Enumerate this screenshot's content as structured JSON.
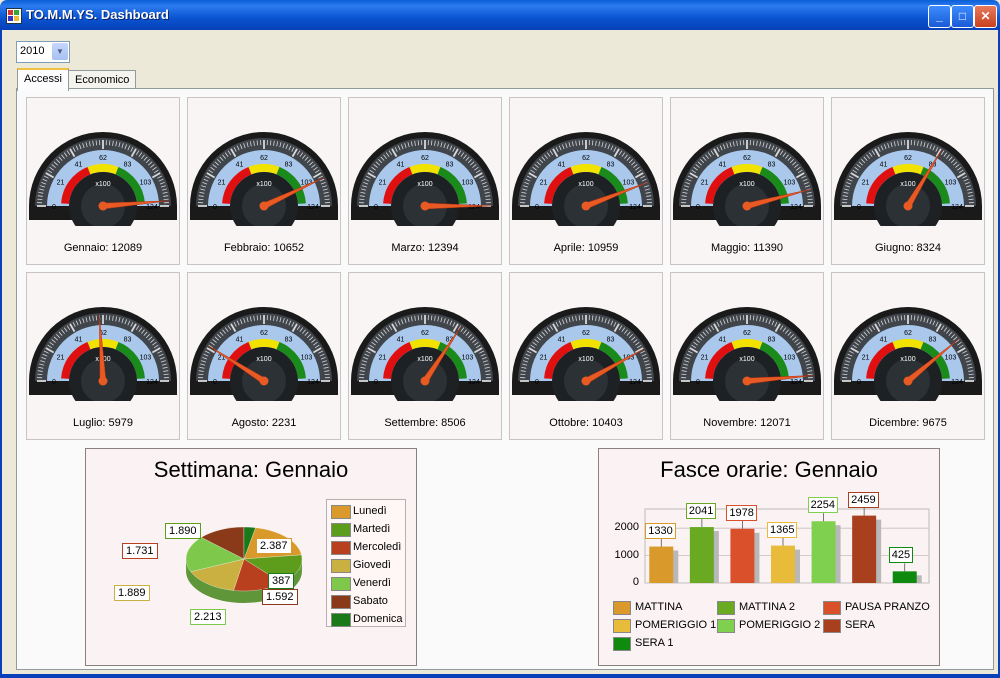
{
  "window": {
    "title": "TO.M.M.YS. Dashboard"
  },
  "year_select": {
    "value": "2010"
  },
  "tabs": [
    {
      "label": "Accessi",
      "active": true
    },
    {
      "label": "Economico",
      "active": false
    }
  ],
  "gauge_scale": {
    "ticks": [
      "0",
      "21",
      "41",
      "62",
      "83",
      "103",
      "124"
    ],
    "unit_label": "x100",
    "max": 124
  },
  "gauges": [
    {
      "label": "Gennaio: 12089",
      "value": 12089
    },
    {
      "label": "Febbraio: 10652",
      "value": 10652
    },
    {
      "label": "Marzo: 12394",
      "value": 12394
    },
    {
      "label": "Aprile: 10959",
      "value": 10959
    },
    {
      "label": "Maggio: 11390",
      "value": 11390
    },
    {
      "label": "Giugno: 8324",
      "value": 8324
    },
    {
      "label": "Luglio: 5979",
      "value": 5979
    },
    {
      "label": "Agosto: 2231",
      "value": 2231
    },
    {
      "label": "Settembre: 8506",
      "value": 8506
    },
    {
      "label": "Ottobre: 10403",
      "value": 10403
    },
    {
      "label": "Novembre: 12071",
      "value": 12071
    },
    {
      "label": "Dicembre: 9675",
      "value": 9675
    }
  ],
  "chart_data": [
    {
      "type": "pie",
      "title": "Settimana: Gennaio",
      "categories": [
        "Lunedì",
        "Martedì",
        "Mercoledì",
        "Giovedì",
        "Venerdì",
        "Sabato",
        "Domenica"
      ],
      "values": [
        2387,
        1890,
        1731,
        1889,
        2213,
        1592,
        387
      ],
      "data_labels": [
        "2.387",
        "1.890",
        "1.731",
        "1.889",
        "2.213",
        "1.592",
        "387"
      ],
      "colors": [
        "#d99a2b",
        "#5e9c1c",
        "#b8401e",
        "#c9b040",
        "#7ec84c",
        "#8a3a18",
        "#1a7a1a"
      ],
      "legend": "right"
    },
    {
      "type": "bar",
      "title": "Fasce orarie: Gennaio",
      "categories": [
        "MATTINA",
        "MATTINA 2",
        "PAUSA PRANZO",
        "POMERIGGIO 1",
        "POMERIGGIO 2",
        "SERA",
        "SERA 1"
      ],
      "values": [
        1330,
        2041,
        1978,
        1365,
        2254,
        2459,
        425
      ],
      "data_labels": [
        "1330",
        "2041",
        "1978",
        "1365",
        "2254",
        "2459",
        "425"
      ],
      "colors": [
        "#d99a2b",
        "#6aaa22",
        "#d9502a",
        "#e8bb3a",
        "#80d050",
        "#a8401e",
        "#0f8a0f"
      ],
      "y_ticks": [
        "0",
        "1000",
        "2000"
      ],
      "ylim": [
        0,
        2700
      ],
      "grid": true,
      "legend": "bottom"
    }
  ]
}
